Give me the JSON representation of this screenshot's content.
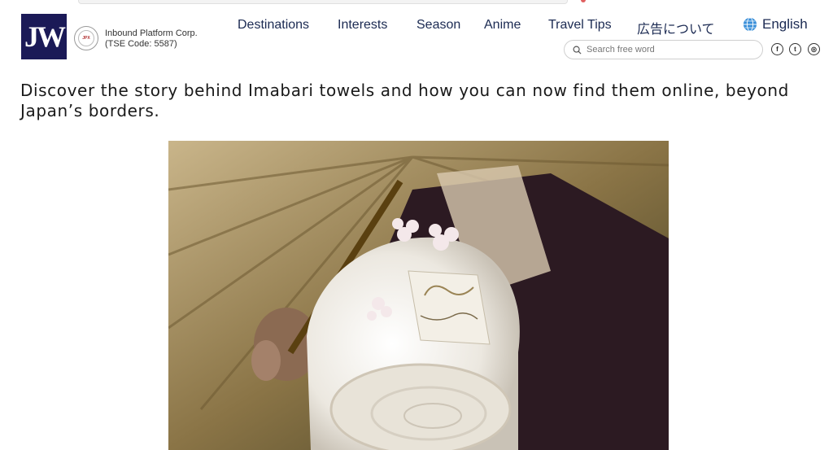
{
  "brand": {
    "logo_text": "JW",
    "company_name": "Inbound Platform Corp.",
    "company_code": "(TSE Code: 5587)",
    "seal_text": "JPX"
  },
  "nav": {
    "items": [
      {
        "label": "Destinations"
      },
      {
        "label": "Interests"
      },
      {
        "label": "Season"
      },
      {
        "label": "Anime"
      },
      {
        "label": "Travel Tips"
      },
      {
        "label": "広告について"
      }
    ],
    "language": "English"
  },
  "search": {
    "placeholder": "Search free word",
    "value": ""
  },
  "social": [
    {
      "name": "facebook-icon",
      "glyph": "f"
    },
    {
      "name": "twitter-icon",
      "glyph": "t"
    },
    {
      "name": "instagram-icon",
      "glyph": "◎"
    }
  ],
  "article": {
    "intro": "Discover the story behind Imabari towels and how you can now find them online, beyond Japan’s borders."
  },
  "colors": {
    "brand_navy": "#1b1a57",
    "nav_text": "#1b2a52"
  }
}
